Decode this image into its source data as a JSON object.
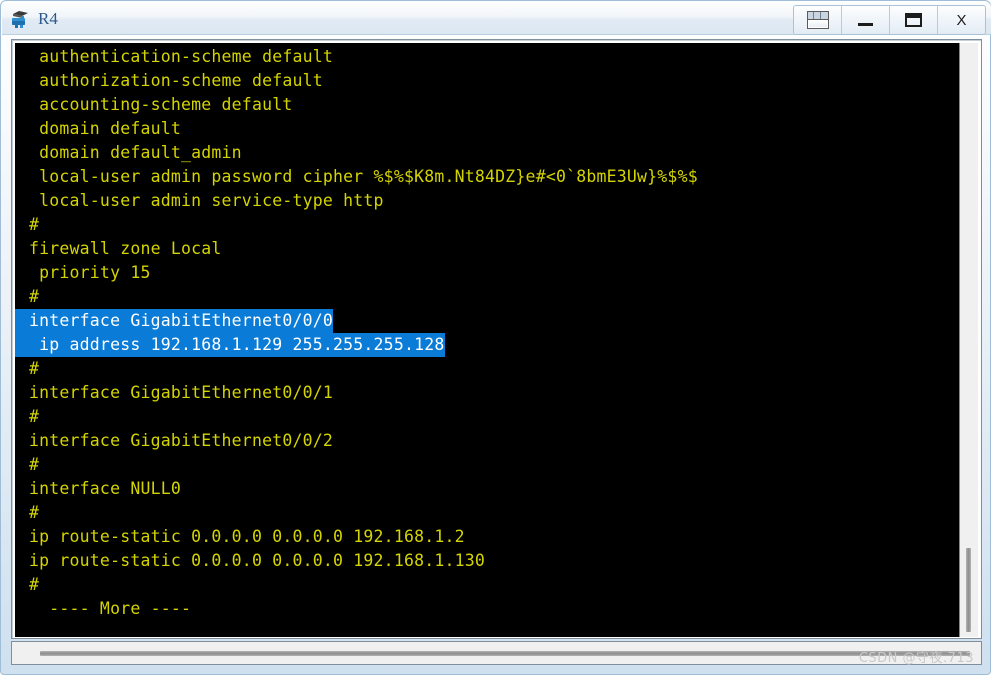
{
  "window": {
    "title": "R4",
    "icon": "router-icon",
    "buttons": [
      {
        "name": "panel-switch-button",
        "icon": "panels-icon",
        "label": ""
      },
      {
        "name": "minimize-button",
        "icon": "minimize-icon",
        "label": ""
      },
      {
        "name": "maximize-button",
        "icon": "maximize-icon",
        "label": ""
      },
      {
        "name": "close-button",
        "icon": "close-icon",
        "label": "X"
      }
    ]
  },
  "terminal": {
    "foreground_color": "#d4d400",
    "background_color": "#000000",
    "selection_background": "#0a7bd6",
    "selection_foreground": "#ffffff",
    "lines": [
      {
        "text": " authentication-scheme default",
        "selected": false
      },
      {
        "text": " authorization-scheme default",
        "selected": false
      },
      {
        "text": " accounting-scheme default",
        "selected": false
      },
      {
        "text": " domain default",
        "selected": false
      },
      {
        "text": " domain default_admin",
        "selected": false
      },
      {
        "text": " local-user admin password cipher %$%$K8m.Nt84DZ}e#<0`8bmE3Uw}%$%$",
        "selected": false
      },
      {
        "text": " local-user admin service-type http",
        "selected": false
      },
      {
        "text": "#",
        "selected": false
      },
      {
        "text": "firewall zone Local",
        "selected": false
      },
      {
        "text": " priority 15",
        "selected": false
      },
      {
        "text": "#",
        "selected": false
      },
      {
        "text": "interface GigabitEthernet0/0/0",
        "selected": true
      },
      {
        "text": " ip address 192.168.1.129 255.255.255.128",
        "selected": true
      },
      {
        "text": "#",
        "selected": false
      },
      {
        "text": "interface GigabitEthernet0/0/1",
        "selected": false
      },
      {
        "text": "#",
        "selected": false
      },
      {
        "text": "interface GigabitEthernet0/0/2",
        "selected": false
      },
      {
        "text": "#",
        "selected": false
      },
      {
        "text": "interface NULL0",
        "selected": false
      },
      {
        "text": "#",
        "selected": false
      },
      {
        "text": "ip route-static 0.0.0.0 0.0.0.0 192.168.1.2",
        "selected": false
      },
      {
        "text": "ip route-static 0.0.0.0 0.0.0.0 192.168.1.130",
        "selected": false
      },
      {
        "text": "#",
        "selected": false
      },
      {
        "text": "  ---- More ----",
        "selected": false
      }
    ]
  },
  "watermark": {
    "text": "CSDN @守夜.713"
  }
}
